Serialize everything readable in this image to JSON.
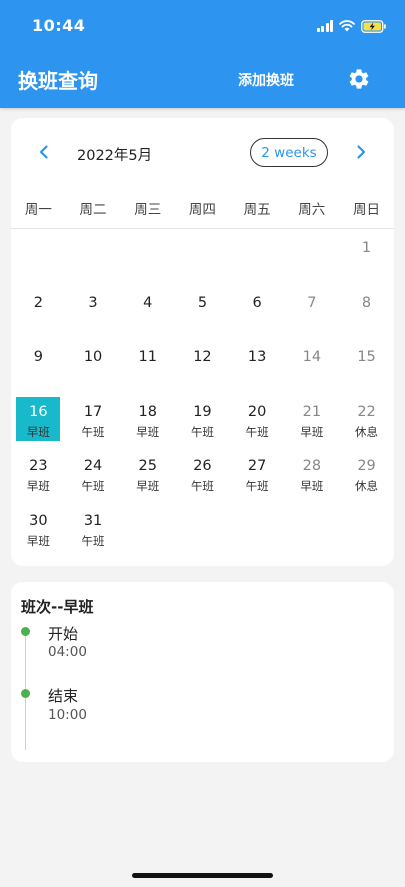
{
  "status_bar": {
    "time": "10:44",
    "signal_icon": "cellular-signal-icon",
    "wifi_icon": "wifi-icon",
    "battery_icon": "battery-charging-icon"
  },
  "header": {
    "title": "换班查询",
    "add_shift_label": "添加换班",
    "settings_icon": "gear-icon",
    "background_color": "#2d95f0"
  },
  "calendar": {
    "month_label": "2022年5月",
    "format_button": "2 weeks",
    "prev_icon": "chevron-left-icon",
    "next_icon": "chevron-right-icon",
    "weekdays": [
      "周一",
      "周二",
      "周三",
      "周四",
      "周五",
      "周六",
      "周日"
    ],
    "selected_day": "16",
    "selected_color": "#18b9ca",
    "days": [
      {
        "day": "1",
        "shift": ""
      },
      {
        "day": "2",
        "shift": ""
      },
      {
        "day": "3",
        "shift": ""
      },
      {
        "day": "4",
        "shift": ""
      },
      {
        "day": "5",
        "shift": ""
      },
      {
        "day": "6",
        "shift": ""
      },
      {
        "day": "7",
        "shift": ""
      },
      {
        "day": "8",
        "shift": ""
      },
      {
        "day": "9",
        "shift": ""
      },
      {
        "day": "10",
        "shift": ""
      },
      {
        "day": "11",
        "shift": ""
      },
      {
        "day": "12",
        "shift": ""
      },
      {
        "day": "13",
        "shift": ""
      },
      {
        "day": "14",
        "shift": ""
      },
      {
        "day": "15",
        "shift": ""
      },
      {
        "day": "16",
        "shift": "早班"
      },
      {
        "day": "17",
        "shift": "午班"
      },
      {
        "day": "18",
        "shift": "早班"
      },
      {
        "day": "19",
        "shift": "午班"
      },
      {
        "day": "20",
        "shift": "午班"
      },
      {
        "day": "21",
        "shift": "早班"
      },
      {
        "day": "22",
        "shift": "休息"
      },
      {
        "day": "23",
        "shift": "早班"
      },
      {
        "day": "24",
        "shift": "午班"
      },
      {
        "day": "25",
        "shift": "早班"
      },
      {
        "day": "26",
        "shift": "午班"
      },
      {
        "day": "27",
        "shift": "午班"
      },
      {
        "day": "28",
        "shift": "早班"
      },
      {
        "day": "29",
        "shift": "休息"
      },
      {
        "day": "30",
        "shift": "早班"
      },
      {
        "day": "31",
        "shift": "午班"
      }
    ]
  },
  "shift_detail": {
    "title": "班次--早班",
    "events": [
      {
        "label": "开始",
        "time": "04:00"
      },
      {
        "label": "结束",
        "time": "10:00"
      }
    ],
    "dot_color": "#4caf50"
  }
}
